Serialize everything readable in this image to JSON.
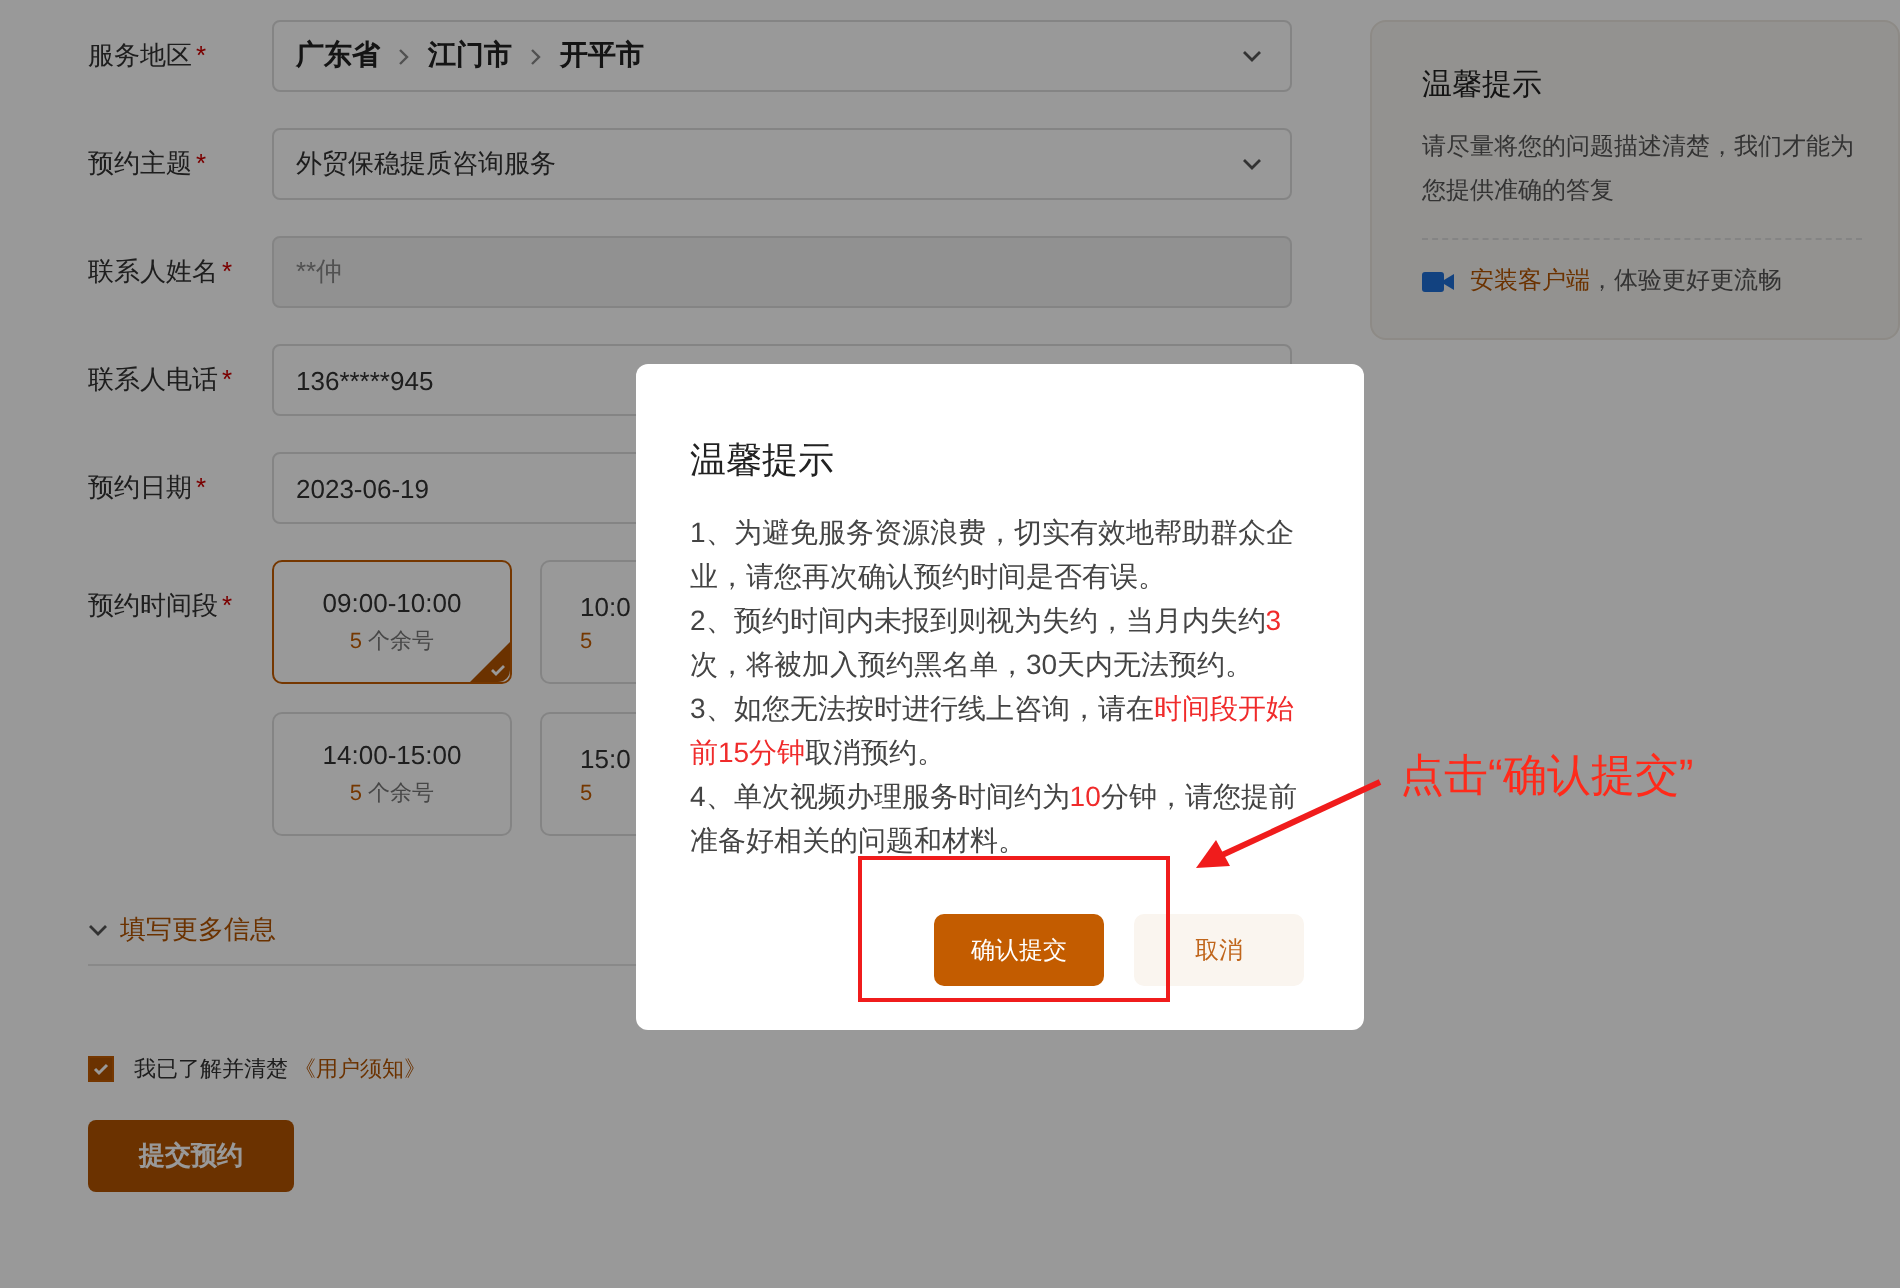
{
  "form": {
    "fields": [
      {
        "label": "服务地区",
        "mark": "*",
        "kind": "region",
        "parts": [
          "广东省",
          "江门市",
          "开平市"
        ]
      },
      {
        "label": "预约主题",
        "mark": "*",
        "kind": "select",
        "value": "外贸保稳提质咨询服务"
      },
      {
        "label": "联系人姓名",
        "mark": "*",
        "kind": "disabled",
        "value": "**仲"
      },
      {
        "label": "联系人电话",
        "mark": "*",
        "kind": "input",
        "value": "136*****945"
      },
      {
        "label": "预约日期",
        "mark": "*",
        "kind": "input",
        "value": "2023-06-19"
      }
    ],
    "time_slots": {
      "label": "预约时间段",
      "mark": "*",
      "slots": [
        {
          "time": "09:00-10:00",
          "count": "5",
          "unit": "个余号",
          "selected": true
        },
        {
          "time": "10:0",
          "count": "5",
          "selected": false
        },
        {
          "time": "14:00-15:00",
          "count": "5",
          "unit": "个余号",
          "selected": false
        },
        {
          "time": "15:0",
          "count": "5",
          "selected": false
        }
      ]
    },
    "more_info": {
      "label": "填写更多信息",
      "expanded": false
    },
    "agreement": {
      "checked": true,
      "text": "我已了解并清楚",
      "link": "《用户须知》"
    },
    "submit_button": "提交预约"
  },
  "tip_card": {
    "title": "温馨提示",
    "text": "请尽量将您的问题描述清楚，我们才能为您提供准确的答复",
    "link": "安装客户端",
    "link_suffix": "，体验更好更流畅"
  },
  "dialog": {
    "title": "温馨提示",
    "paragraphs": [
      [
        {
          "text": "1、为避免服务资源浪费，切实有效地帮助群众企业，请您再次确认预约时间是否有误。",
          "highlight": false
        }
      ],
      [
        {
          "text": "2、预约时间内未报到则视为失约，当月内失约",
          "highlight": false
        },
        {
          "text": "3",
          "highlight": true
        },
        {
          "text": "次，将被加入预约黑名单，30天内无法预约。",
          "highlight": false
        }
      ],
      [
        {
          "text": "3、如您无法按时进行线上咨询，请在",
          "highlight": false
        },
        {
          "text": "时间段开始前15分钟",
          "highlight": true
        },
        {
          "text": "取消预约。",
          "highlight": false
        }
      ],
      [
        {
          "text": "4、单次视频办理服务时间约为",
          "highlight": false
        },
        {
          "text": "10",
          "highlight": true
        },
        {
          "text": "分钟，请您提前准备好相关的问题和材料。",
          "highlight": false
        }
      ]
    ],
    "buttons": [
      {
        "label": "确认提交",
        "kind": "primary"
      },
      {
        "label": "取消",
        "kind": "secondary"
      }
    ]
  },
  "annotation": {
    "text": "点击“确认提交”"
  }
}
